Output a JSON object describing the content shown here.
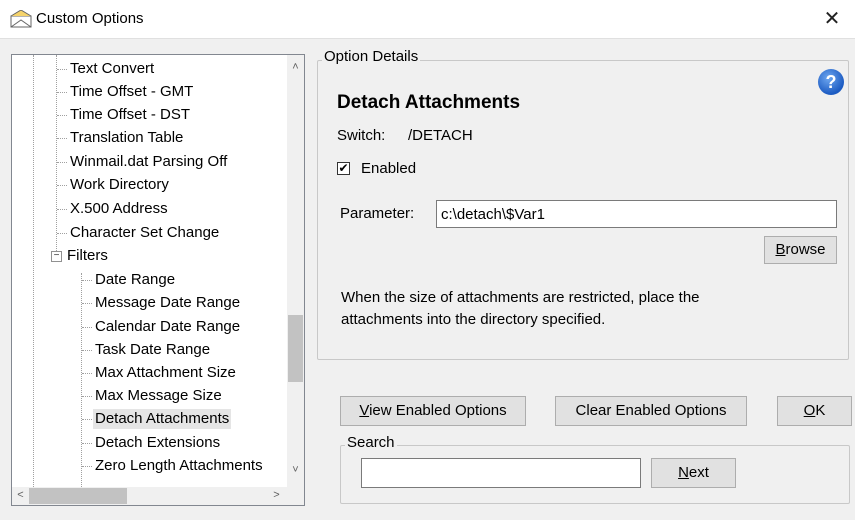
{
  "window": {
    "title": "Custom Options",
    "close_glyph": "✕"
  },
  "tree": {
    "items": [
      "Text Convert",
      "Time Offset - GMT",
      "Time Offset - DST",
      "Translation Table",
      "Winmail.dat Parsing Off",
      "Work Directory",
      "X.500 Address",
      "Character Set Change",
      "Filters",
      "Date Range",
      "Message Date Range",
      "Calendar Date Range",
      "Task Date Range",
      "Max Attachment Size",
      "Max Message Size",
      "Detach Attachments",
      "Detach Extensions",
      "Zero Length Attachments"
    ],
    "selected": "Detach Attachments",
    "expander_glyph": "−"
  },
  "details": {
    "legend": "Option Details",
    "title": "Detach Attachments",
    "switch_label": "Switch:",
    "switch_value": "/DETACH",
    "enabled_label": "Enabled",
    "enabled_checked": true,
    "check_glyph": "✔",
    "parameter_label": "Parameter:",
    "parameter_value": "c:\\detach\\$Var1",
    "browse_mnemonic": "B",
    "browse_rest": "rowse",
    "description": "When the size of attachments are restricted, place the attachments into the directory specified.",
    "help_glyph": "?"
  },
  "buttons": {
    "view_mnemonic": "V",
    "view_rest": "iew Enabled Options",
    "clear_label": "Clear Enabled Options",
    "ok_mnemonic": "O",
    "ok_rest": "K"
  },
  "search": {
    "legend": "Search",
    "value": "",
    "next_mnemonic": "N",
    "next_rest": "ext"
  },
  "colors": {
    "help_blue": "#1c5bc2",
    "selection": "#e5e5e5"
  }
}
